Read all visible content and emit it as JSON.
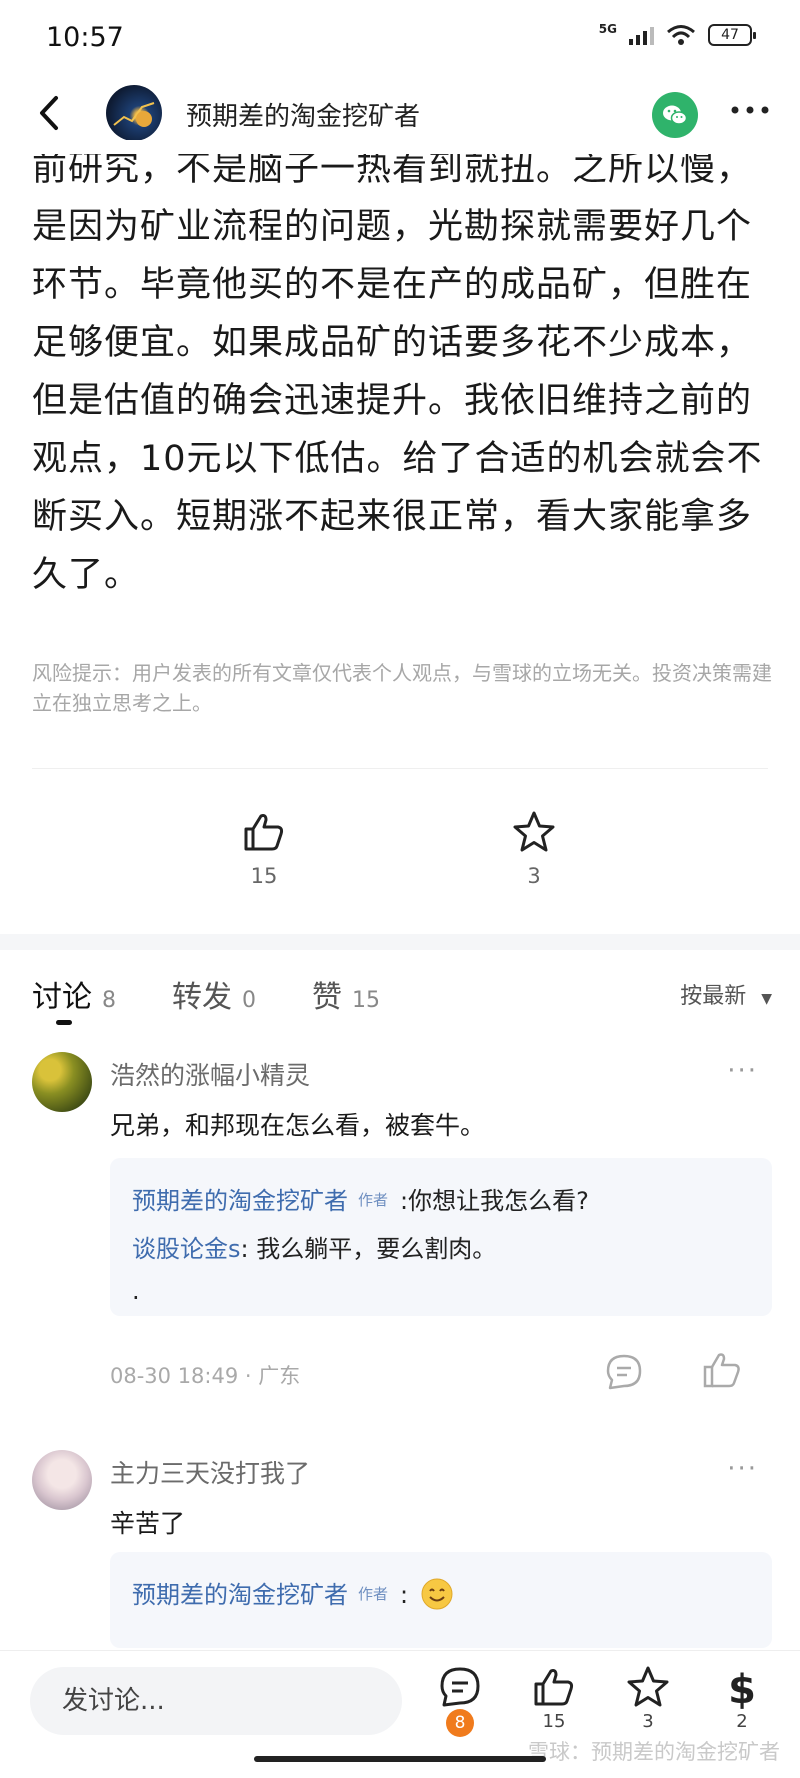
{
  "status_bar": {
    "time": "10:57",
    "network": "5G",
    "battery": "47"
  },
  "header": {
    "title": "预期差的淘金挖矿者"
  },
  "article": {
    "lines": [
      "前研究，不是脑子一热看到就扭。之所以慢，",
      "是因为矿业流程的问题，光勘探就需要好几个",
      "环节。毕竟他买的不是在产的成品矿，但胜在",
      "足够便宜。如果成品矿的话要多花不少成本，",
      "但是估值的确会迅速提升。我依旧维持之前的",
      "观点，10元以下低估。给了合适的机会就会不",
      "断买入。短期涨不起来很正常，看大家能拿多",
      "久了。"
    ],
    "risk_notice": "风险提示：用户发表的所有文章仅代表个人观点，与雪球的立场无关。投资决策需建立在独立思考之上。"
  },
  "actions": {
    "like_count": "15",
    "favorite_count": "3"
  },
  "tabs": [
    {
      "label": "讨论",
      "count": "8"
    },
    {
      "label": "转发",
      "count": "0"
    },
    {
      "label": "赞",
      "count": "15"
    }
  ],
  "sort_label": "按最新",
  "comments": [
    {
      "user": "浩然的涨幅小精灵",
      "text": "兄弟，和邦现在怎么看，被套牛。",
      "replies": [
        {
          "author": "预期差的淘金挖矿者",
          "badge": "作者",
          "text": ":你想让我怎么看?"
        },
        {
          "author": "谈股论金s",
          "text": ": 我么躺平，要么割肉。"
        },
        {
          "text": "."
        }
      ],
      "time": "08-30 18:49",
      "location": "广东"
    },
    {
      "user": "主力三天没打我了",
      "text": "辛苦了",
      "replies": [
        {
          "author": "预期差的淘金挖矿者",
          "badge": "作者",
          "text": ":"
        }
      ]
    }
  ],
  "bottom_bar": {
    "input_placeholder": "发讨论...",
    "comment_count": "8",
    "like_count": "15",
    "favorite_count": "3",
    "reward_count": "2"
  },
  "watermark": "雪球：预期差的淘金挖矿者"
}
